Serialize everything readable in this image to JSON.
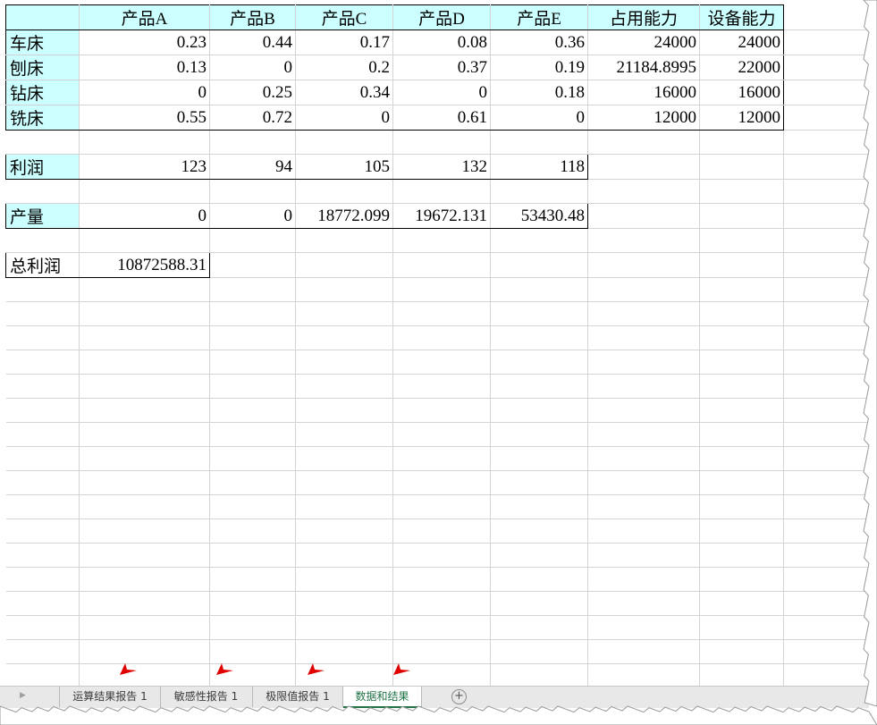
{
  "columns": [
    "",
    "产品A",
    "产品B",
    "产品C",
    "产品D",
    "产品E",
    "占用能力",
    "设备能力"
  ],
  "machines": [
    {
      "name": "车床",
      "values": [
        "0.23",
        "0.44",
        "0.17",
        "0.08",
        "0.36"
      ],
      "used": "24000",
      "capacity": "24000"
    },
    {
      "name": "刨床",
      "values": [
        "0.13",
        "0",
        "0.2",
        "0.37",
        "0.19"
      ],
      "used": "21184.8995",
      "capacity": "22000"
    },
    {
      "name": "钻床",
      "values": [
        "0",
        "0.25",
        "0.34",
        "0",
        "0.18"
      ],
      "used": "16000",
      "capacity": "16000"
    },
    {
      "name": "铣床",
      "values": [
        "0.55",
        "0.72",
        "0",
        "0.61",
        "0"
      ],
      "used": "12000",
      "capacity": "12000"
    }
  ],
  "profit": {
    "label": "利润",
    "values": [
      "123",
      "94",
      "105",
      "132",
      "118"
    ]
  },
  "output": {
    "label": "产量",
    "values": [
      "0",
      "0",
      "18772.099",
      "19672.131",
      "53430.48"
    ]
  },
  "total_profit": {
    "label": "总利润",
    "value": "10872588.31"
  },
  "sheet_tabs": [
    {
      "label": "运算结果报告 1",
      "active": false
    },
    {
      "label": "敏感性报告 1",
      "active": false
    },
    {
      "label": "极限值报告 1",
      "active": false
    },
    {
      "label": "数据和结果",
      "active": true
    }
  ],
  "add_sheet_symbol": "+",
  "colors": {
    "header_fill": "#ccffff",
    "active_tab": "#217346",
    "marker": "#e00000"
  }
}
